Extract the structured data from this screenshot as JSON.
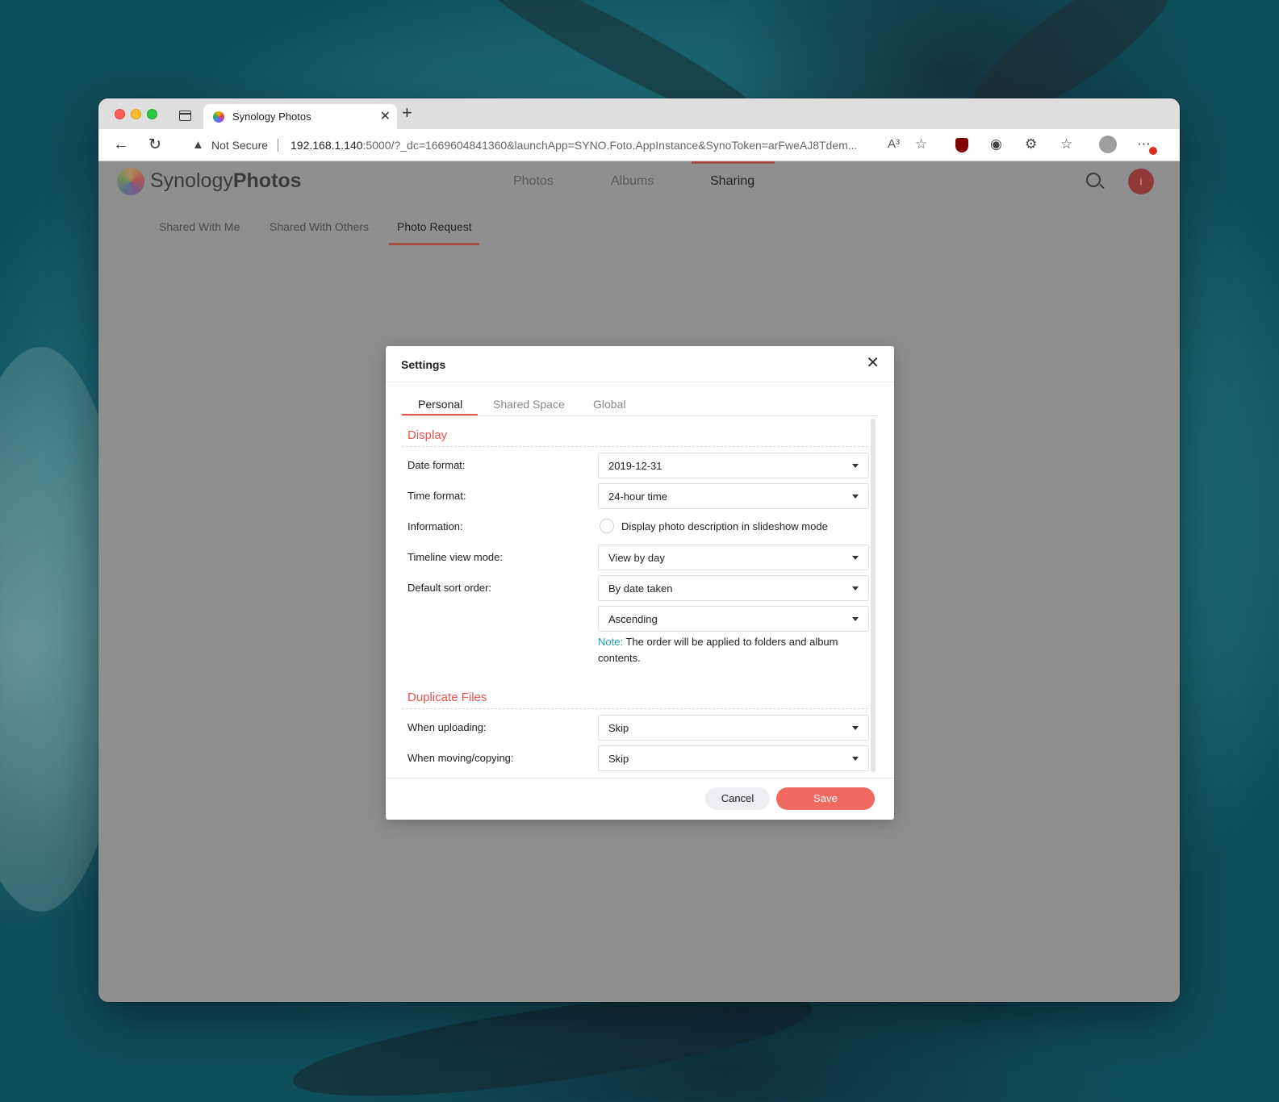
{
  "browser": {
    "tab_title": "Synology Photos",
    "new_tab_glyph": "+",
    "security_label": "Not Secure",
    "url_host": "192.168.1.140",
    "url_rest": ":5000/?_dc=1669604841360&launchApp=SYNO.Foto.AppInstance&SynoToken=arFweAJ8Tdem...",
    "read_aloud_label": "A³"
  },
  "app": {
    "logo_light": "Synology",
    "logo_bold": "Photos",
    "nav_tabs": [
      {
        "label": "Photos"
      },
      {
        "label": "Albums"
      },
      {
        "label": "Sharing",
        "active": true
      }
    ],
    "sub_tabs": [
      {
        "label": "Shared With Me"
      },
      {
        "label": "Shared With Others"
      },
      {
        "label": "Photo Request",
        "active": true
      }
    ],
    "avatar_initial": "i"
  },
  "modal": {
    "title": "Settings",
    "close_glyph": "✕",
    "tabs": [
      {
        "label": "Personal",
        "active": true
      },
      {
        "label": "Shared Space"
      },
      {
        "label": "Global"
      }
    ],
    "display": {
      "section_title": "Display",
      "date_format_label": "Date format:",
      "date_format_value": "2019-12-31",
      "time_format_label": "Time format:",
      "time_format_value": "24-hour time",
      "information_label": "Information:",
      "information_option": "Display photo description in slideshow mode",
      "information_checked": false,
      "timeline_label": "Timeline view mode:",
      "timeline_value": "View by day",
      "sort_label": "Default sort order:",
      "sort_by_value": "By date taken",
      "sort_direction_value": "Ascending",
      "note_key": "Note:",
      "note_text": " The order will be applied to folders and album contents."
    },
    "duplicates": {
      "section_title": "Duplicate Files",
      "uploading_label": "When uploading:",
      "uploading_value": "Skip",
      "moving_label": "When moving/copying:",
      "moving_value": "Skip"
    },
    "cancel_label": "Cancel",
    "save_label": "Save"
  },
  "colors": {
    "accent": "#e8554e",
    "save_button": "#f06a60",
    "note_key": "#1a9db3"
  }
}
